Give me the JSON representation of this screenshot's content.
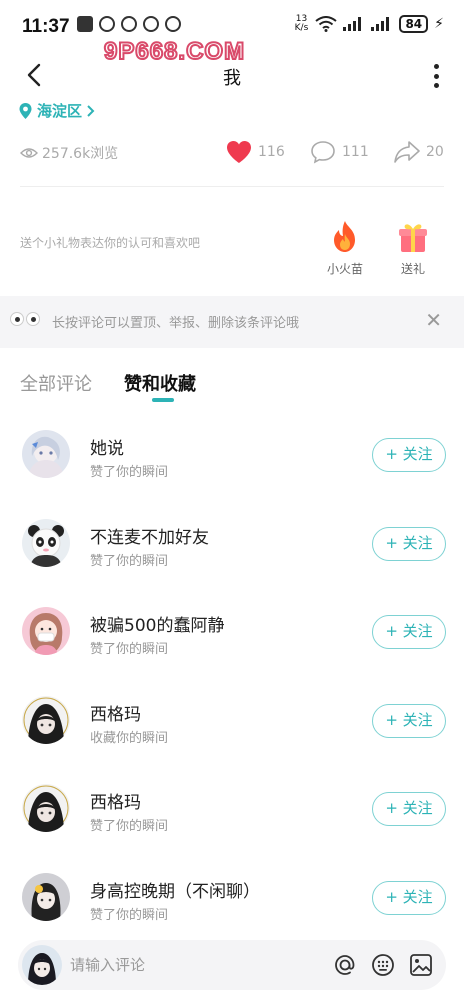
{
  "status_bar": {
    "time": "11:37",
    "net_speed_value": "13",
    "net_speed_unit": "K/s",
    "wifi_badge": "6",
    "battery": "84"
  },
  "watermark": "9P668.COM",
  "header": {
    "title": "我"
  },
  "location": {
    "label": "海淀区"
  },
  "stats": {
    "views": "257.6k浏览",
    "likes": "116",
    "comments": "111",
    "shares": "20"
  },
  "gifts": {
    "prompt": "送个小礼物表达你的认可和喜欢吧",
    "items": [
      {
        "label": "小火苗",
        "icon": "flame-icon"
      },
      {
        "label": "送礼",
        "icon": "gift-icon"
      }
    ]
  },
  "tip": {
    "text": "长按评论可以置顶、举报、删除该条评论哦"
  },
  "tabs": [
    {
      "label": "全部评论",
      "active": false
    },
    {
      "label": "赞和收藏",
      "active": true
    }
  ],
  "users": [
    {
      "name": "她说",
      "action": "赞了你的瞬间",
      "follow": "+ 关注"
    },
    {
      "name": "不连麦不加好友",
      "action": "赞了你的瞬间",
      "follow": "+ 关注"
    },
    {
      "name": "被骗500的蠢阿静",
      "action": "赞了你的瞬间",
      "follow": "+ 关注"
    },
    {
      "name": "西格玛",
      "action": "收藏你的瞬间",
      "follow": "+ 关注"
    },
    {
      "name": "西格玛",
      "action": "赞了你的瞬间",
      "follow": "+ 关注"
    },
    {
      "name": "身高控晚期（不闲聊）",
      "action": "赞了你的瞬间",
      "follow": "+ 关注"
    }
  ],
  "comment_bar": {
    "placeholder": "请输入评论"
  },
  "colors": {
    "accent": "#2db3b6",
    "like": "#ef3a4f",
    "watermark": "#d94a6a"
  }
}
